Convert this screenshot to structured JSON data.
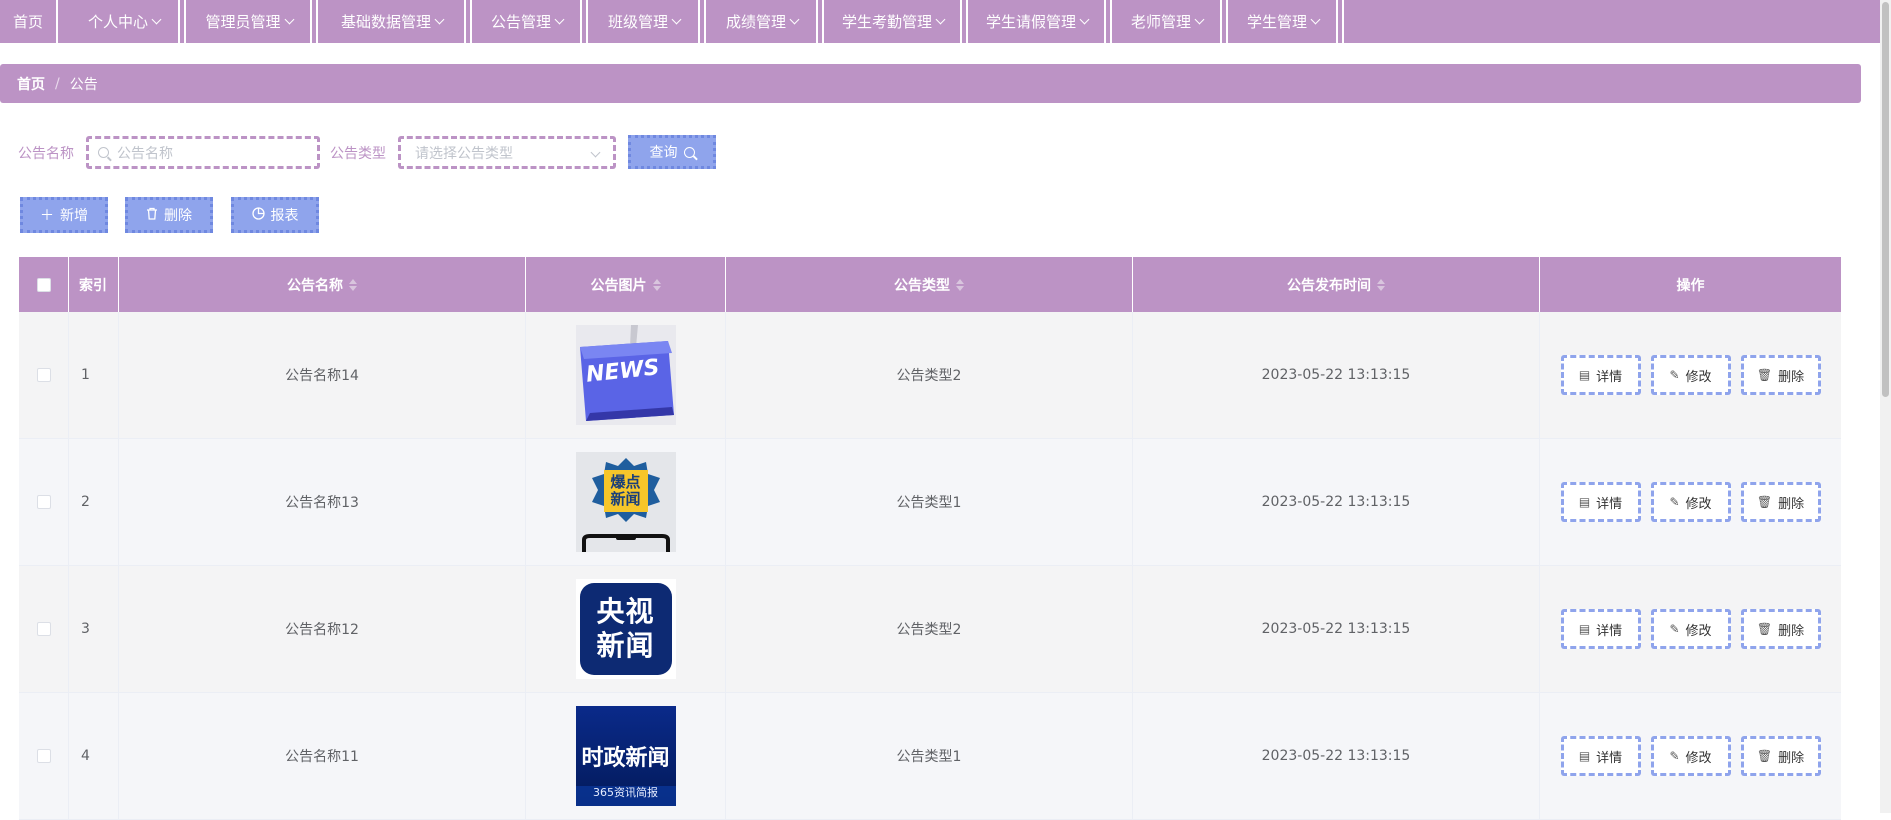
{
  "nav": {
    "items": [
      {
        "label": "首页",
        "dropdown": false
      },
      {
        "label": "个人中心",
        "dropdown": true
      },
      {
        "label": "管理员管理",
        "dropdown": true
      },
      {
        "label": "基础数据管理",
        "dropdown": true
      },
      {
        "label": "公告管理",
        "dropdown": true
      },
      {
        "label": "班级管理",
        "dropdown": true
      },
      {
        "label": "成绩管理",
        "dropdown": true
      },
      {
        "label": "学生考勤管理",
        "dropdown": true
      },
      {
        "label": "学生请假管理",
        "dropdown": true
      },
      {
        "label": "老师管理",
        "dropdown": true
      },
      {
        "label": "学生管理",
        "dropdown": true
      }
    ]
  },
  "breadcrumb": {
    "home": "首页",
    "separator": "/",
    "current": "公告"
  },
  "search": {
    "name_label": "公告名称",
    "name_placeholder": "公告名称",
    "type_label": "公告类型",
    "type_placeholder": "请选择公告类型",
    "query_label": "查询"
  },
  "actions": {
    "add_label": "新增",
    "delete_label": "删除",
    "report_label": "报表"
  },
  "table": {
    "headers": {
      "index": "索引",
      "name": "公告名称",
      "image": "公告图片",
      "type": "公告类型",
      "time": "公告发布时间",
      "ops": "操作"
    },
    "rows": [
      {
        "index": "1",
        "name": "公告名称14",
        "image_text": "NEWS",
        "type": "公告类型2",
        "time": "2023-05-22 13:13:15"
      },
      {
        "index": "2",
        "name": "公告名称13",
        "image_text": "爆点新闻",
        "type": "公告类型1",
        "time": "2023-05-22 13:13:15"
      },
      {
        "index": "3",
        "name": "公告名称12",
        "image_text": "央视新闻",
        "type": "公告类型2",
        "time": "2023-05-22 13:13:15"
      },
      {
        "index": "4",
        "name": "公告名称11",
        "image_text": "时政新闻",
        "image_subtext": "365资讯简报",
        "type": "公告类型1",
        "time": "2023-05-22 13:13:15"
      }
    ],
    "row_actions": {
      "detail": "详情",
      "edit": "修改",
      "delete": "删除"
    }
  },
  "colors": {
    "primary": "#bc93c5",
    "button": "#8fa4ec",
    "button_border": "#6f88e0"
  }
}
